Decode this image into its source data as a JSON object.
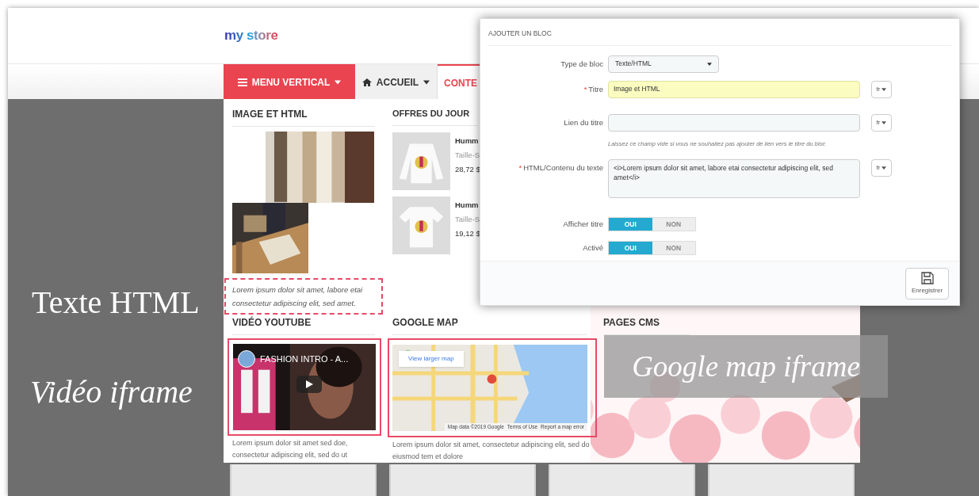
{
  "store": {
    "logo": "my store",
    "nav": [
      {
        "label": "MENU VERTICAL",
        "kind": "menu",
        "selected": false
      },
      {
        "label": "ACCUEIL",
        "kind": "home",
        "selected": false
      },
      {
        "label": "CONTE",
        "kind": "plain",
        "selected": true
      }
    ]
  },
  "mega_menu": {
    "image_html": {
      "title": "IMAGE ET HTML",
      "caption": "Lorem ipsum dolor sit amet, labore etai consectetur adipiscing elit, sed amet."
    },
    "offers": {
      "title": "OFFRES DU JOUR",
      "products": [
        {
          "name": "Humm",
          "size": "Taille-S",
          "price": "28,72 $"
        },
        {
          "name": "Humm",
          "size": "Taille-S",
          "price": "19,12 $"
        }
      ]
    },
    "video": {
      "title": "VIDÉO YOUTUBE",
      "video_title": "FASHION INTRO - A...",
      "description": "Lorem ipsum dolor sit amet sed doe, consectetur adipiscing elit, sed do ut"
    },
    "map": {
      "title": "GOOGLE MAP",
      "button": "View larger map",
      "footer": [
        "Map data ©2019 Google",
        "Terms of Use",
        "Report a map error"
      ],
      "description": "Lorem ipsum dolor sit amet, consectetur adipiscing elit, sed do eiusmod tem et dolore"
    },
    "cms": {
      "title": "PAGES CMS"
    }
  },
  "overlay_labels": {
    "text_html": "Texte HTML",
    "video_iframe": "Vidéo iframe",
    "map_iframe": "Google map iframe"
  },
  "modal": {
    "title": "AJOUTER UN BLOC",
    "fields": [
      {
        "kind": "select",
        "label": "Type de bloc",
        "value": "Texte/HTML"
      },
      {
        "kind": "text",
        "label": "Titre",
        "required": "*",
        "value": "Image et HTML",
        "focused": true,
        "lang": "fr"
      },
      {
        "kind": "text",
        "label": "Lien du titre",
        "focused": false,
        "lang": "fr",
        "help": "Laissez ce champ vide si vous ne souhaitez pas ajouter de lien vers le titre du bloc"
      },
      {
        "kind": "textarea",
        "label": "HTML/Contenu du texte",
        "required": "*",
        "value": "<i>Lorem ipsum dolor sit amet, labore etai consectetur adipiscing elit, sed amet</i>",
        "lang": "fr"
      },
      {
        "kind": "toggle",
        "label": "Afficher titre",
        "options": [
          "OUI",
          "NON"
        ],
        "on": true
      },
      {
        "kind": "toggle",
        "label": "Activé",
        "options": [
          "OUI",
          "NON"
        ],
        "on": true
      }
    ],
    "save": "Enregistrer"
  }
}
